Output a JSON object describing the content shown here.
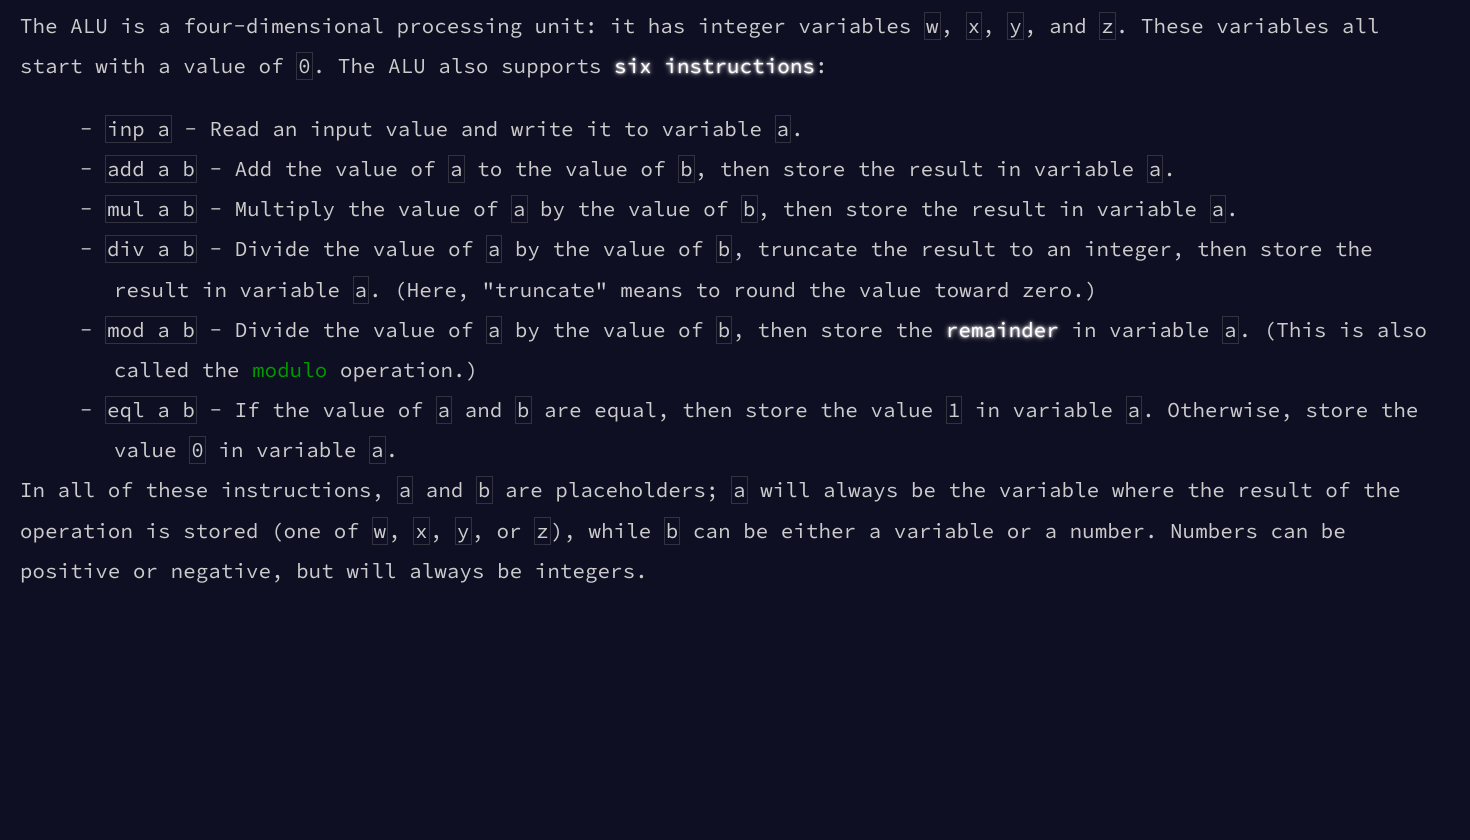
{
  "para1": {
    "t0": "The ALU is a four-dimensional processing unit: it has integer variables ",
    "w": "w",
    "t1": ", ",
    "x": "x",
    "t2": ", ",
    "y": "y",
    "t3": ", and ",
    "z": "z",
    "t4": ". These variables all start with a value of ",
    "zero": "0",
    "t5": ". The ALU also supports ",
    "six": "six instructions",
    "t6": ":"
  },
  "instr": [
    {
      "cmd": "inp a",
      "t0": " - Read an input value and write it to variable ",
      "a0": "a",
      "t1": "."
    },
    {
      "cmd": "add a b",
      "t0": " - Add the value of ",
      "a0": "a",
      "t1": " to the value of ",
      "b0": "b",
      "t2": ", then store the result in variable ",
      "a1": "a",
      "t3": "."
    },
    {
      "cmd": "mul a b",
      "t0": " - Multiply the value of ",
      "a0": "a",
      "t1": " by the value of ",
      "b0": "b",
      "t2": ", then store the result in variable ",
      "a1": "a",
      "t3": "."
    },
    {
      "cmd": "div a b",
      "t0": " - Divide the value of ",
      "a0": "a",
      "t1": " by the value of ",
      "b0": "b",
      "t2": ", truncate the result to an integer, then store the result in variable ",
      "a1": "a",
      "t3": ". (Here, \"truncate\" means to round the value toward zero.)"
    },
    {
      "cmd": "mod a b",
      "t0": " - Divide the value of ",
      "a0": "a",
      "t1": " by the value of ",
      "b0": "b",
      "t2": ", then store the ",
      "em": "remainder",
      "t3": " in variable ",
      "a1": "a",
      "t4": ". (This is also called the ",
      "link": "modulo",
      "t5": " operation.)"
    },
    {
      "cmd": "eql a b",
      "t0": " - If the value of ",
      "a0": "a",
      "t1": " and ",
      "b0": "b",
      "t2": " are equal, then store the value ",
      "one": "1",
      "t3": " in variable ",
      "a1": "a",
      "t4": ". Otherwise, store the value ",
      "zero": "0",
      "t5": " in variable ",
      "a2": "a",
      "t6": "."
    }
  ],
  "para2": {
    "t0": "In all of these instructions, ",
    "a0": "a",
    "t1": " and ",
    "b0": "b",
    "t2": " are placeholders; ",
    "a1": "a",
    "t3": " will always be the variable where the result of the operation is stored (one of ",
    "w": "w",
    "t4": ", ",
    "x": "x",
    "t5": ", ",
    "y": "y",
    "t6": ", or ",
    "z": "z",
    "t7": "), while ",
    "b1": "b",
    "t8": " can be either a variable or a number. Numbers can be positive or negative, but will always be integers."
  }
}
